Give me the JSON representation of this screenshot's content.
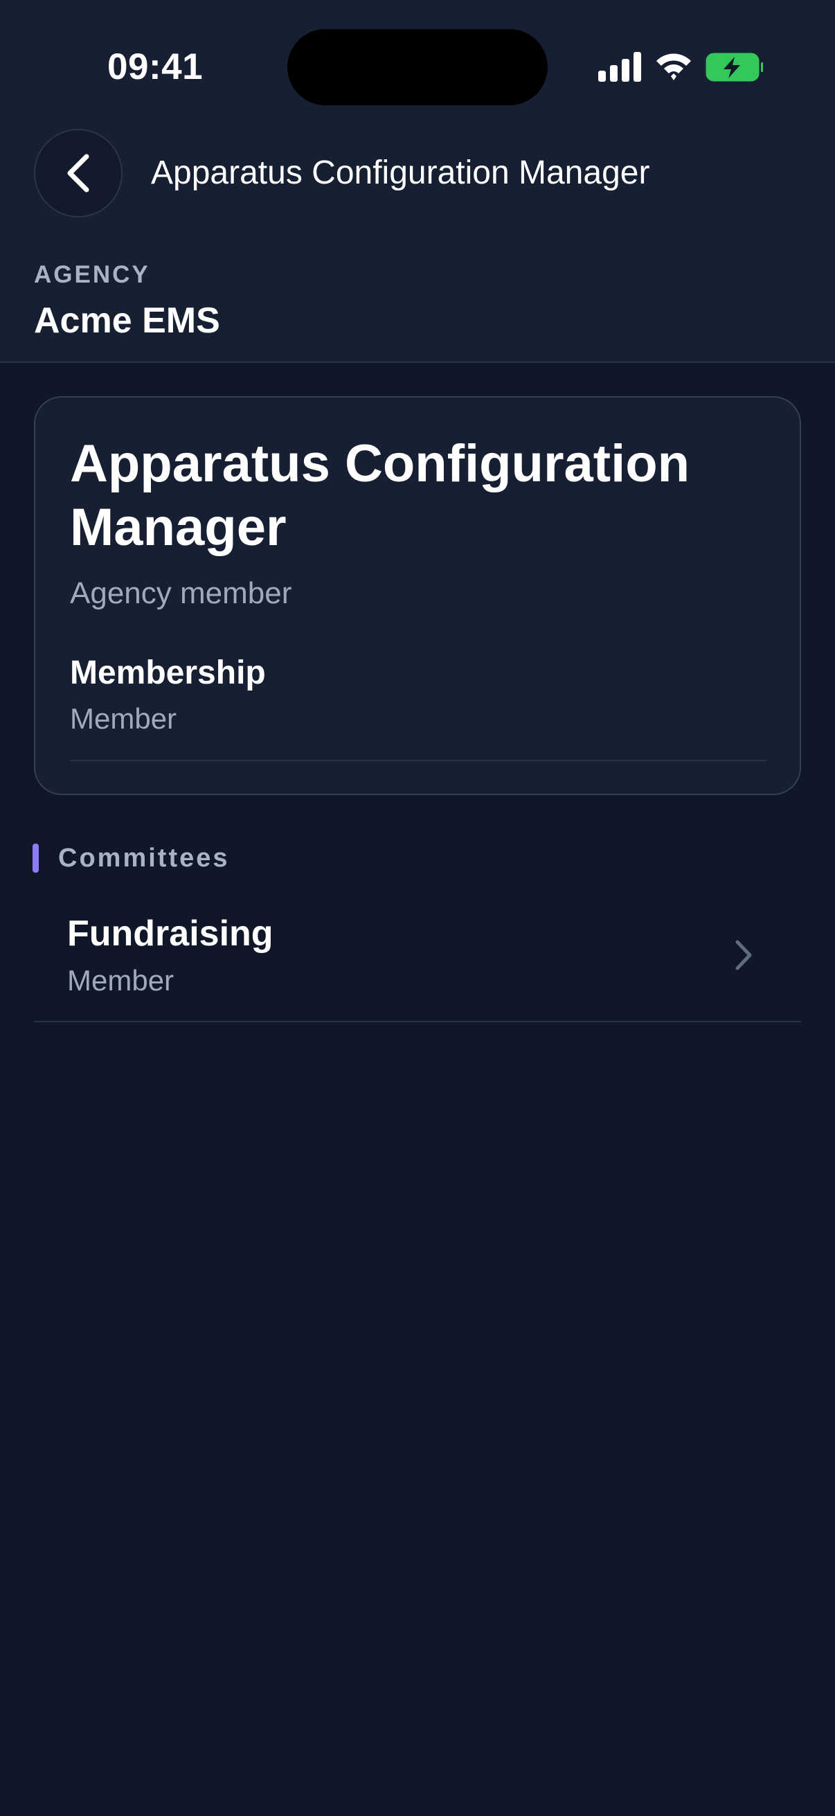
{
  "status_bar": {
    "time": "09:41",
    "icons": [
      "cellular-signal-icon",
      "wifi-icon",
      "battery-charging-icon"
    ]
  },
  "header": {
    "back_icon": "chevron-left-icon",
    "title": "Apparatus Configuration Manager"
  },
  "agency": {
    "label": "AGENCY",
    "name": "Acme EMS"
  },
  "card": {
    "title": "Apparatus Configuration Manager",
    "subtitle": "Agency member",
    "membership_label": "Membership",
    "membership_value": "Member"
  },
  "committees": {
    "section_title": "Committees",
    "items": [
      {
        "name": "Fundraising",
        "role": "Member",
        "icon": "chevron-right-icon"
      }
    ]
  },
  "colors": {
    "background": "#101729",
    "surface": "#172033",
    "accent": "#8b7cf6",
    "muted_text": "#a1aabd",
    "battery": "#34c759"
  }
}
